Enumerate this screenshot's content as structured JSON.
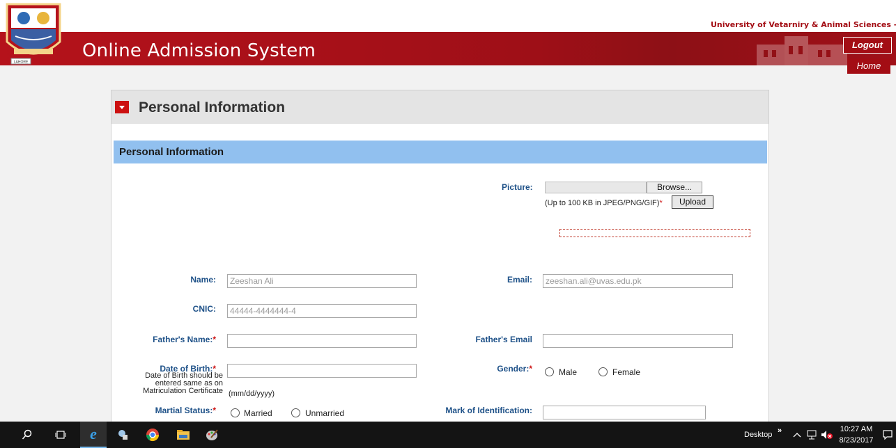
{
  "header": {
    "university_name": "University of Vetarniry & Animal Sciences - Lahore",
    "app_title": "Online Admission System",
    "logout_label": "Logout",
    "home_label": "Home",
    "logo_caption": "LAHORE"
  },
  "panel": {
    "title": "Personal Information",
    "section_title": "Personal Information"
  },
  "picture": {
    "label": "Picture:",
    "browse_label": "Browse...",
    "hint": "(Up to 100 KB in JPEG/PNG/GIF)",
    "upload_label": "Upload"
  },
  "form": {
    "name_label": "Name:",
    "name_value": "Zeeshan Ali",
    "email_label": "Email:",
    "email_value": "zeeshan.ali@uvas.edu.pk",
    "cnic_label": "CNIC:",
    "cnic_value": "44444-4444444-4",
    "father_name_label": "Father's Name:",
    "father_email_label": "Father's Email",
    "dob_label": "Date of Birth:",
    "dob_note": [
      "Date of Birth should be",
      "entered same as on",
      "Matriculation Certificate"
    ],
    "dob_format": "(mm/dd/yyyy)",
    "gender_label": "Gender:",
    "gender_options": [
      "Male",
      "Female"
    ],
    "marital_label": "Martial Status:",
    "marital_options": [
      "Married",
      "Unmarried"
    ],
    "identification_label": "Mark of Identification:",
    "required_mark": "*"
  },
  "taskbar": {
    "desktop_label": "Desktop",
    "time": "10:27 AM",
    "date": "8/23/2017"
  }
}
